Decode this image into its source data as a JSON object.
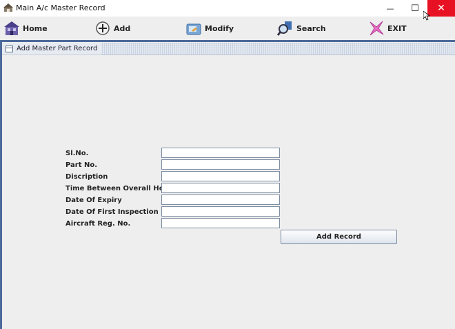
{
  "window": {
    "title": "Main A/c Master Record",
    "minimize_glyph": "—",
    "maximize_glyph": "☐",
    "close_glyph": "✕"
  },
  "toolbar": {
    "items": [
      {
        "label": "Home",
        "icon": "home-icon"
      },
      {
        "label": "Add",
        "icon": "add-icon"
      },
      {
        "label": "Modify",
        "icon": "modify-icon"
      },
      {
        "label": "Search",
        "icon": "search-icon"
      },
      {
        "label": "EXIT",
        "icon": "exit-icon"
      }
    ]
  },
  "internal_frame": {
    "title": "Add Master Part Record"
  },
  "form": {
    "fields": [
      {
        "label": "Sl.No.",
        "value": ""
      },
      {
        "label": "Part No.",
        "value": ""
      },
      {
        "label": "Discription",
        "value": ""
      },
      {
        "label": "Time Between Overall Hour's",
        "value": ""
      },
      {
        "label": "Date Of Expiry",
        "value": ""
      },
      {
        "label": "Date Of First Inspection",
        "value": ""
      },
      {
        "label": "Aircraft Reg. No.",
        "value": ""
      }
    ],
    "submit_label": "Add Record"
  },
  "colors": {
    "accent": "#4c6a9a",
    "close_button": "#e81123",
    "background": "#eeeeee"
  }
}
